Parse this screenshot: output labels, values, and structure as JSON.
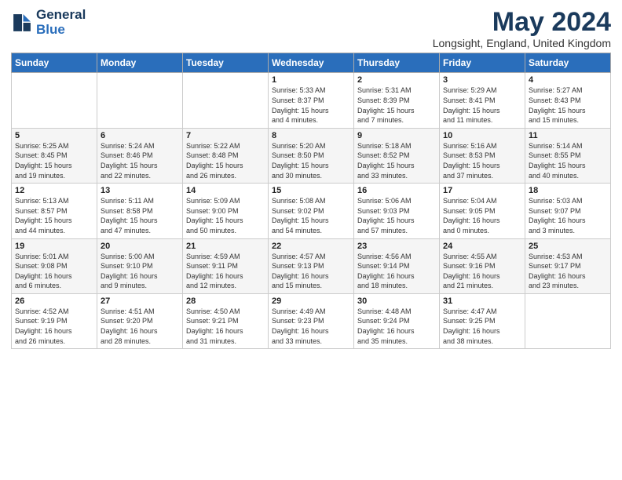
{
  "header": {
    "logo_line1": "General",
    "logo_line2": "Blue",
    "title": "May 2024",
    "subtitle": "Longsight, England, United Kingdom"
  },
  "days_of_week": [
    "Sunday",
    "Monday",
    "Tuesday",
    "Wednesday",
    "Thursday",
    "Friday",
    "Saturday"
  ],
  "weeks": [
    [
      {
        "day": "",
        "info": ""
      },
      {
        "day": "",
        "info": ""
      },
      {
        "day": "",
        "info": ""
      },
      {
        "day": "1",
        "info": "Sunrise: 5:33 AM\nSunset: 8:37 PM\nDaylight: 15 hours\nand 4 minutes."
      },
      {
        "day": "2",
        "info": "Sunrise: 5:31 AM\nSunset: 8:39 PM\nDaylight: 15 hours\nand 7 minutes."
      },
      {
        "day": "3",
        "info": "Sunrise: 5:29 AM\nSunset: 8:41 PM\nDaylight: 15 hours\nand 11 minutes."
      },
      {
        "day": "4",
        "info": "Sunrise: 5:27 AM\nSunset: 8:43 PM\nDaylight: 15 hours\nand 15 minutes."
      }
    ],
    [
      {
        "day": "5",
        "info": "Sunrise: 5:25 AM\nSunset: 8:45 PM\nDaylight: 15 hours\nand 19 minutes."
      },
      {
        "day": "6",
        "info": "Sunrise: 5:24 AM\nSunset: 8:46 PM\nDaylight: 15 hours\nand 22 minutes."
      },
      {
        "day": "7",
        "info": "Sunrise: 5:22 AM\nSunset: 8:48 PM\nDaylight: 15 hours\nand 26 minutes."
      },
      {
        "day": "8",
        "info": "Sunrise: 5:20 AM\nSunset: 8:50 PM\nDaylight: 15 hours\nand 30 minutes."
      },
      {
        "day": "9",
        "info": "Sunrise: 5:18 AM\nSunset: 8:52 PM\nDaylight: 15 hours\nand 33 minutes."
      },
      {
        "day": "10",
        "info": "Sunrise: 5:16 AM\nSunset: 8:53 PM\nDaylight: 15 hours\nand 37 minutes."
      },
      {
        "day": "11",
        "info": "Sunrise: 5:14 AM\nSunset: 8:55 PM\nDaylight: 15 hours\nand 40 minutes."
      }
    ],
    [
      {
        "day": "12",
        "info": "Sunrise: 5:13 AM\nSunset: 8:57 PM\nDaylight: 15 hours\nand 44 minutes."
      },
      {
        "day": "13",
        "info": "Sunrise: 5:11 AM\nSunset: 8:58 PM\nDaylight: 15 hours\nand 47 minutes."
      },
      {
        "day": "14",
        "info": "Sunrise: 5:09 AM\nSunset: 9:00 PM\nDaylight: 15 hours\nand 50 minutes."
      },
      {
        "day": "15",
        "info": "Sunrise: 5:08 AM\nSunset: 9:02 PM\nDaylight: 15 hours\nand 54 minutes."
      },
      {
        "day": "16",
        "info": "Sunrise: 5:06 AM\nSunset: 9:03 PM\nDaylight: 15 hours\nand 57 minutes."
      },
      {
        "day": "17",
        "info": "Sunrise: 5:04 AM\nSunset: 9:05 PM\nDaylight: 16 hours\nand 0 minutes."
      },
      {
        "day": "18",
        "info": "Sunrise: 5:03 AM\nSunset: 9:07 PM\nDaylight: 16 hours\nand 3 minutes."
      }
    ],
    [
      {
        "day": "19",
        "info": "Sunrise: 5:01 AM\nSunset: 9:08 PM\nDaylight: 16 hours\nand 6 minutes."
      },
      {
        "day": "20",
        "info": "Sunrise: 5:00 AM\nSunset: 9:10 PM\nDaylight: 16 hours\nand 9 minutes."
      },
      {
        "day": "21",
        "info": "Sunrise: 4:59 AM\nSunset: 9:11 PM\nDaylight: 16 hours\nand 12 minutes."
      },
      {
        "day": "22",
        "info": "Sunrise: 4:57 AM\nSunset: 9:13 PM\nDaylight: 16 hours\nand 15 minutes."
      },
      {
        "day": "23",
        "info": "Sunrise: 4:56 AM\nSunset: 9:14 PM\nDaylight: 16 hours\nand 18 minutes."
      },
      {
        "day": "24",
        "info": "Sunrise: 4:55 AM\nSunset: 9:16 PM\nDaylight: 16 hours\nand 21 minutes."
      },
      {
        "day": "25",
        "info": "Sunrise: 4:53 AM\nSunset: 9:17 PM\nDaylight: 16 hours\nand 23 minutes."
      }
    ],
    [
      {
        "day": "26",
        "info": "Sunrise: 4:52 AM\nSunset: 9:19 PM\nDaylight: 16 hours\nand 26 minutes."
      },
      {
        "day": "27",
        "info": "Sunrise: 4:51 AM\nSunset: 9:20 PM\nDaylight: 16 hours\nand 28 minutes."
      },
      {
        "day": "28",
        "info": "Sunrise: 4:50 AM\nSunset: 9:21 PM\nDaylight: 16 hours\nand 31 minutes."
      },
      {
        "day": "29",
        "info": "Sunrise: 4:49 AM\nSunset: 9:23 PM\nDaylight: 16 hours\nand 33 minutes."
      },
      {
        "day": "30",
        "info": "Sunrise: 4:48 AM\nSunset: 9:24 PM\nDaylight: 16 hours\nand 35 minutes."
      },
      {
        "day": "31",
        "info": "Sunrise: 4:47 AM\nSunset: 9:25 PM\nDaylight: 16 hours\nand 38 minutes."
      },
      {
        "day": "",
        "info": ""
      }
    ]
  ]
}
